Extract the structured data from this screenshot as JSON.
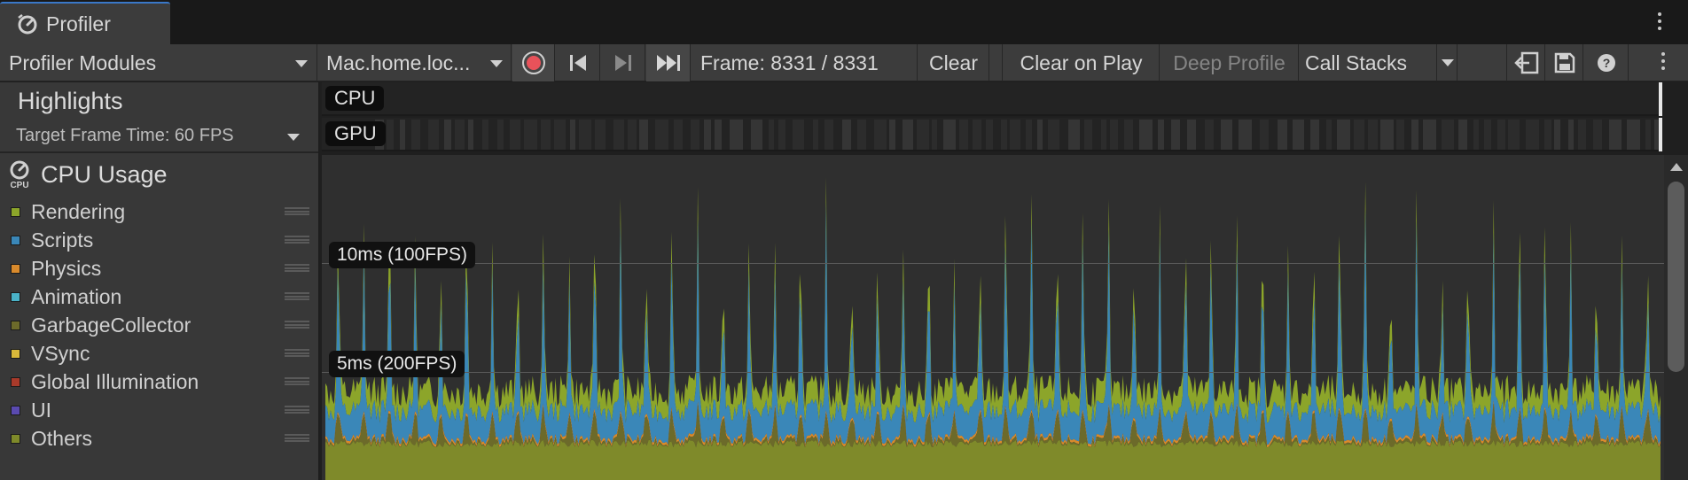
{
  "window": {
    "tab_title": "Profiler",
    "tab_icon": "profiler-gauge-icon"
  },
  "toolbar": {
    "modules_label": "Profiler Modules",
    "target_label": "Mac.home.loc...",
    "frame_label": "Frame: 8331 / 8331",
    "clear_label": "Clear",
    "clear_on_play_label": "Clear on Play",
    "deep_profile_label": "Deep Profile",
    "call_stacks_label": "Call Stacks",
    "record_active": true,
    "icons": [
      "record-icon",
      "previous-frame-icon",
      "next-frame-icon",
      "current-frame-icon",
      "load-icon",
      "save-icon",
      "help-icon",
      "more-icon"
    ]
  },
  "highlights": {
    "title": "Highlights",
    "target_frame_time": "Target Frame Time: 60 FPS",
    "rows": [
      "CPU",
      "GPU"
    ]
  },
  "cpu_module": {
    "title": "CPU Usage",
    "legend": [
      {
        "label": "Rendering",
        "color": "#8ca52a"
      },
      {
        "label": "Scripts",
        "color": "#3a87b8"
      },
      {
        "label": "Physics",
        "color": "#d98a2c"
      },
      {
        "label": "Animation",
        "color": "#4ab2c7"
      },
      {
        "label": "GarbageCollector",
        "color": "#6c6a2a"
      },
      {
        "label": "VSync",
        "color": "#d9b83a"
      },
      {
        "label": "Global Illumination",
        "color": "#a83a2a"
      },
      {
        "label": "UI",
        "color": "#5a4ab0"
      },
      {
        "label": "Others",
        "color": "#7f8a2a"
      }
    ],
    "gridlines": [
      {
        "label": "10ms (100FPS)",
        "ms": 10
      },
      {
        "label": "5ms (200FPS)",
        "ms": 5
      }
    ],
    "spike_count": 52,
    "chart_max_ms": 15
  }
}
